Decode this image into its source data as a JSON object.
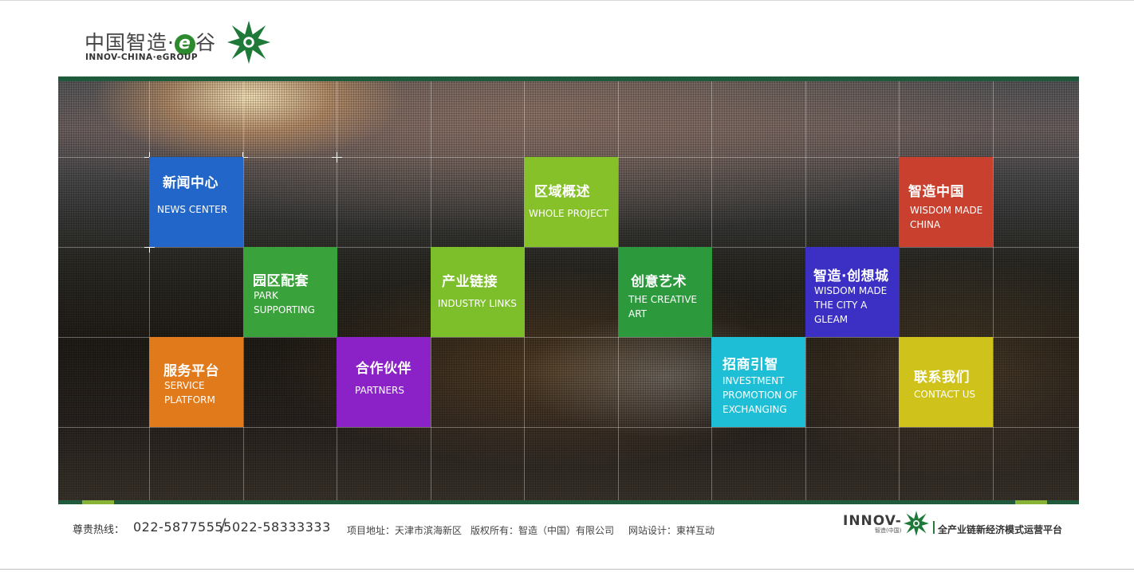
{
  "logo": {
    "cn_text": "中国智造·",
    "e_char": "e",
    "cn_suffix": "谷",
    "en_text": "INNOV-CHINA·eGROUP",
    "star_icon": "green-star-icon",
    "star_color": "#1f7a3a"
  },
  "tiles": [
    {
      "id": "news",
      "cn": "新闻中心",
      "en": "NEWS CENTER",
      "color": "#2166c8"
    },
    {
      "id": "park",
      "cn": "园区配套",
      "en": "PARK SUPPORTING",
      "color": "#3aa23a"
    },
    {
      "id": "service",
      "cn": "服务平台",
      "en": "SERVICE PLATFORM",
      "color": "#e07a1a"
    },
    {
      "id": "partners",
      "cn": "合作伙伴",
      "en": "PARTNERS",
      "color": "#8a22c8"
    },
    {
      "id": "industry",
      "cn": "产业链接",
      "en": "INDUSTRY LINKS",
      "color": "#7dbf2a"
    },
    {
      "id": "region",
      "cn": "区域概述",
      "en": "WHOLE PROJECT",
      "color": "#86c12a"
    },
    {
      "id": "creative",
      "cn": "创意艺术",
      "en": "THE CREATIVE ART",
      "color": "#2c9a3c"
    },
    {
      "id": "invest",
      "cn": "招商引智",
      "en": "INVESTMENT PROMOTION OF EXCHANGING",
      "color": "#1ebfd6"
    },
    {
      "id": "wisdom_city",
      "cn": "智造·创想城",
      "en": "WISDOM MADE THE CITY A GLEAM",
      "color": "#3b2fc4"
    },
    {
      "id": "contact",
      "cn": "联系我们",
      "en": "CONTACT US",
      "color": "#cfc21a"
    },
    {
      "id": "wisdom_china",
      "cn": "智造中国",
      "en": "WISDOM MADE CHINA",
      "color": "#c9412e"
    }
  ],
  "footer": {
    "hotline_label": "尊贵热线：",
    "phone1": "022-58775555",
    "phone_sep": "/",
    "phone2": "022-58333333",
    "address": "项目地址：天津市滨海新区",
    "copyright": "版权所有：智造（中国）有限公司",
    "design": "网站设计：東祥互动",
    "brand_word": "INNOV-",
    "brand_sub": "智造(中国)",
    "brand_icon": "green-star-icon",
    "brand_tagline": "全产业链新经济模式运营平台"
  }
}
